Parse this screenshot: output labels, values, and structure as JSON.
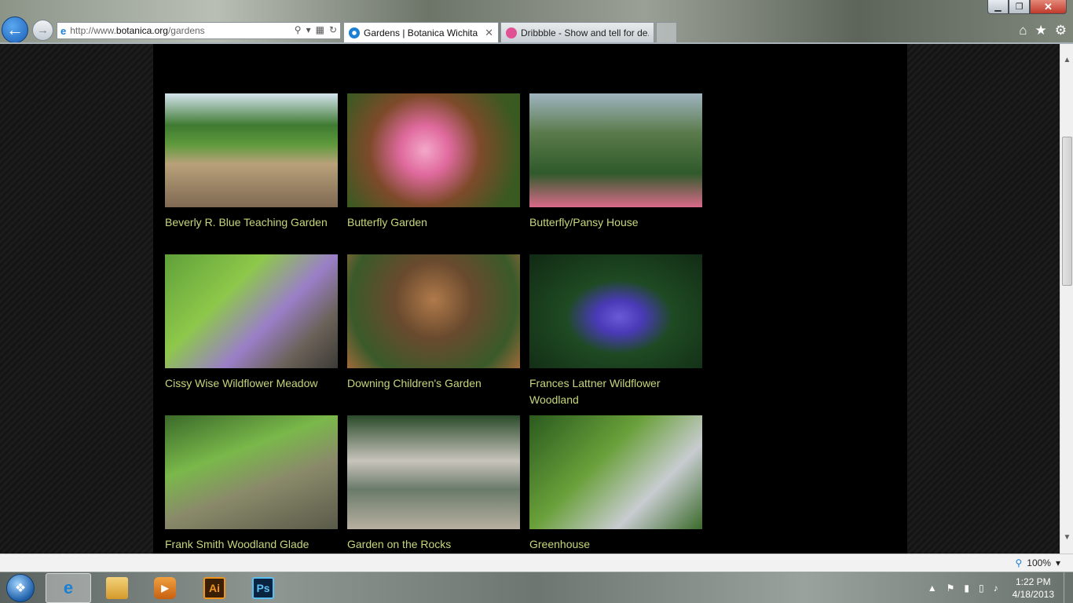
{
  "browser": {
    "address": {
      "scheme": "http://www.",
      "host": "botanica.org",
      "path": "/gardens"
    },
    "tabs": [
      {
        "label": "Gardens | Botanica Wichita",
        "active": true
      },
      {
        "label": "Dribbble - Show and tell for de...",
        "active": false
      }
    ],
    "window_controls": {
      "minimize": "▁",
      "restore": "❐",
      "close": "✕"
    },
    "zoom": "100%"
  },
  "gallery": {
    "items": [
      {
        "label": "Beverly R. Blue Teaching Garden"
      },
      {
        "label": "Butterfly Garden"
      },
      {
        "label": "Butterfly/Pansy House"
      },
      {
        "label": "Cissy Wise Wildflower Meadow"
      },
      {
        "label": "Downing Children's Garden"
      },
      {
        "label": "Frances Lattner Wildflower Woodland"
      },
      {
        "label": "Frank Smith Woodland Glade"
      },
      {
        "label": "Garden on the Rocks"
      },
      {
        "label": "Greenhouse"
      }
    ]
  },
  "taskbar": {
    "apps": {
      "ai": "Ai",
      "ps": "Ps"
    },
    "clock": {
      "time": "1:22 PM",
      "date": "4/18/2013"
    }
  },
  "icons": {
    "back": "arrow-left-icon",
    "forward": "arrow-right-icon",
    "home": "home-icon",
    "favorites": "star-icon",
    "tools": "gear-icon"
  }
}
